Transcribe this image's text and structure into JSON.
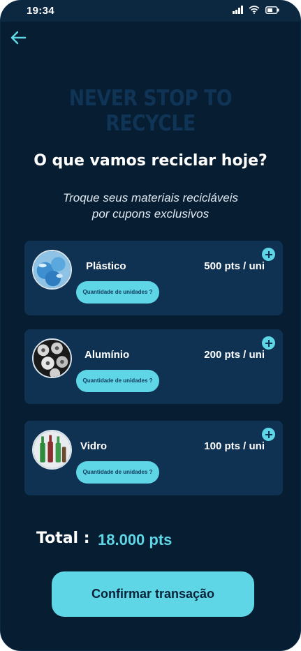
{
  "status_bar": {
    "time": "19:34"
  },
  "hero": {
    "background_text": "NEVER STOP TO RECYCLE"
  },
  "title": "O que vamos reciclar hoje?",
  "subtitle": [
    "Troque seus materiais recicláveis",
    "por cupons exclusivos"
  ],
  "materials": [
    {
      "name": "Plástico",
      "price": "500 pts / uni",
      "quantity_label": "Quantidade de unidades ?",
      "icon": "plastic-bottles-icon"
    },
    {
      "name": "Alumínio",
      "price": "200 pts / uni",
      "quantity_label": "Quantidade de unidades ?",
      "icon": "aluminum-cans-icon"
    },
    {
      "name": "Vidro",
      "price": "100 pts / uni",
      "quantity_label": "Quantidade de unidades ?",
      "icon": "glass-bottles-icon"
    }
  ],
  "total": {
    "label": "Total :",
    "value": "18.000 pts"
  },
  "confirm_button": "Confirmar transação",
  "colors": {
    "background": "#071d31",
    "card": "#0f3253",
    "accent": "#5ed6e6",
    "text": "#ffffff"
  }
}
